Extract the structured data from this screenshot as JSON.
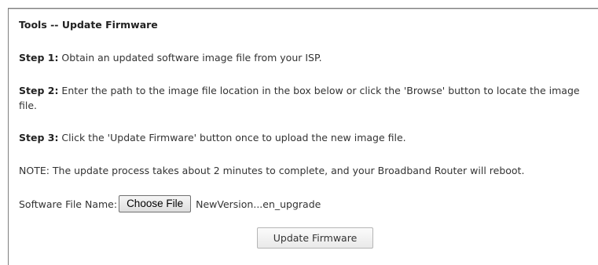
{
  "page": {
    "title": "Tools -- Update Firmware"
  },
  "steps": [
    {
      "label": "Step 1:",
      "text": " Obtain an updated software image file from your ISP."
    },
    {
      "label": "Step 2:",
      "text": " Enter the path to the image file location in the box below or click the 'Browse' button to locate the image file."
    },
    {
      "label": "Step 3:",
      "text": " Click the 'Update Firmware' button once to upload the new image file."
    }
  ],
  "note": "NOTE: The update process takes about 2 minutes to complete, and your Broadband Router will reboot.",
  "file_field": {
    "label": "Software File Name:",
    "button_label": "Choose File",
    "selected_file": "NewVersion...en_upgrade"
  },
  "actions": {
    "update_label": "Update Firmware"
  }
}
